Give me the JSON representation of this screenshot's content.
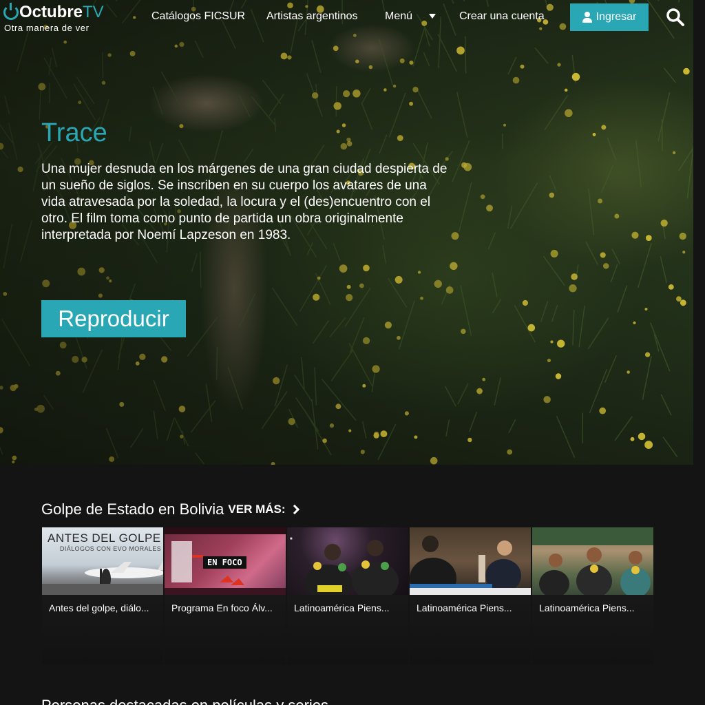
{
  "brand": {
    "name": "Octubre",
    "tv": "TV",
    "tagline": "Otra manera de ver",
    "accent": "#2aa7b5"
  },
  "nav": {
    "items": [
      {
        "label": "Catálogos FICSUR"
      },
      {
        "label": "Artistas argentinos"
      },
      {
        "label": "Menú"
      },
      {
        "label": "Crear una cuenta"
      }
    ],
    "login_label": "Ingresar",
    "login_icon": "user-icon",
    "search_icon": "search-icon"
  },
  "hero": {
    "title": "Trace",
    "description": "Una mujer desnuda en los márgenes de una gran ciudad despierta de un sueño de siglos. Se inscriben en su cuerpo los avatares de una vida atravesada por la soledad, la locura y el (des)encuentro con el otro. El film toma como punto de partida un obra originalmente interpretada por Noemí Lapzeson en 1983.",
    "play_label": "Reproducir"
  },
  "section": {
    "title": "Golpe de Estado en Bolivia",
    "see_more": "VER MÁS:",
    "cards": [
      {
        "title": "Antes del golpe, diálo...",
        "thumb_title": "ANTES DEL GOLPE",
        "thumb_sub": "DIÁLOGOS CON EVO MORALES"
      },
      {
        "title": "Programa En foco Álv...",
        "thumb_title": "EN FOCO"
      },
      {
        "title": "Latinoamérica Piens..."
      },
      {
        "title": "Latinoamérica Piens..."
      },
      {
        "title": "Latinoamérica Piens..."
      }
    ]
  },
  "section2": {
    "title": "Personas destacadas en películas y series"
  }
}
